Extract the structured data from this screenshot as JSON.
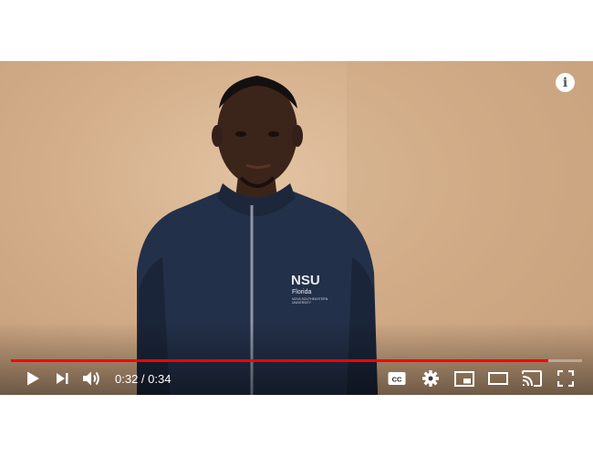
{
  "player": {
    "info_icon_glyph": "i",
    "time": {
      "current": "0:32",
      "separator": " / ",
      "duration": "0:34"
    },
    "progress_fraction": 0.941,
    "colors": {
      "progress": "#ff0000",
      "controls": "#ffffff"
    },
    "jacket": {
      "logo": "NSU",
      "sub1": "Florida",
      "sub2": "NOVA SOUTHEASTERN",
      "sub3": "UNIVERSITY"
    },
    "icons": {
      "play": "play-icon",
      "next": "next-icon",
      "volume": "volume-icon",
      "captions": "captions-icon",
      "settings": "settings-gear-icon",
      "miniplayer": "miniplayer-icon",
      "theater": "theater-mode-icon",
      "cast": "cast-icon",
      "fullscreen": "fullscreen-icon",
      "info": "info-icon"
    }
  }
}
